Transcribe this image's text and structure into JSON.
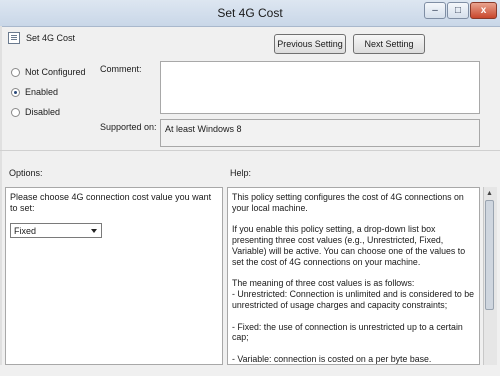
{
  "window": {
    "title": "Set 4G Cost",
    "minimize": "–",
    "maximize": "□",
    "close": "x"
  },
  "header": {
    "policy_name": "Set 4G Cost",
    "prev_button": "Previous Setting",
    "next_button": "Next Setting"
  },
  "state": {
    "not_configured": "Not Configured",
    "enabled": "Enabled",
    "disabled": "Disabled",
    "selected": "Enabled"
  },
  "fields": {
    "comment_label": "Comment:",
    "comment_value": "",
    "supported_label": "Supported on:",
    "supported_value": "At least Windows 8"
  },
  "options": {
    "label": "Options:",
    "prompt": "Please choose 4G connection cost value you want to set:",
    "select_value": "Fixed"
  },
  "help": {
    "label": "Help:",
    "paragraphs": [
      "This policy setting configures the cost of 4G connections on your local machine.",
      "If you enable this policy setting, a drop-down list box presenting three cost values (e.g., Unrestricted, Fixed, Variable) will be active. You can choose one of the values to set the cost of 4G connections on your machine.",
      "The meaning of three cost values is as follows:\n- Unrestricted: Connection is unlimited and is considered to be unrestricted of usage charges and capacity constraints;",
      "- Fixed: the use of connection is unrestricted up to a certain cap;",
      "- Variable: connection is costed on a per byte base."
    ]
  },
  "scrollbar": {
    "up_arrow": "▲"
  }
}
